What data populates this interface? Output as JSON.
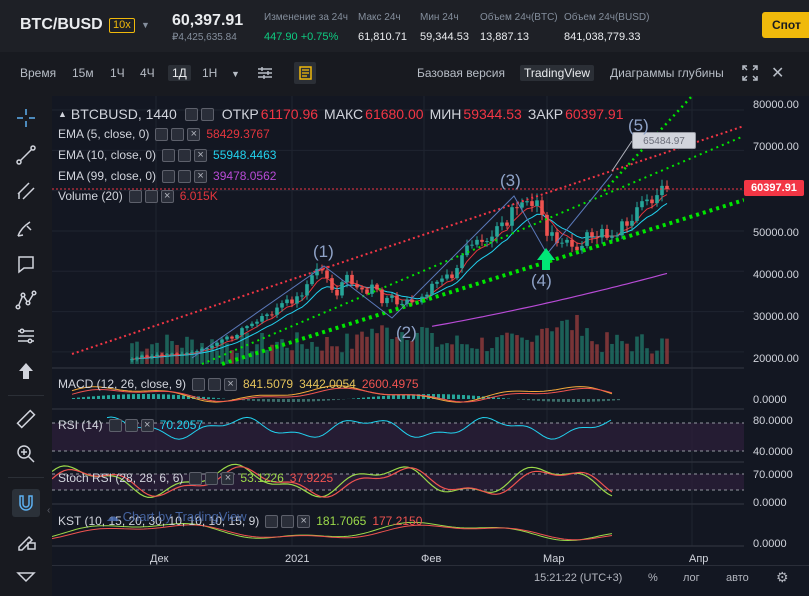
{
  "header": {
    "symbol": "BTC/BUSD",
    "leverage": "10x",
    "last_price": "60,397.91",
    "last_price_local": "₽4,425,635.84",
    "stats": [
      {
        "label": "Изменение за 24ч",
        "value": "447.90 +0.75%"
      },
      {
        "label": "Макс 24ч",
        "value": "61,810.71"
      },
      {
        "label": "Мин 24ч",
        "value": "59,344.53"
      },
      {
        "label": "Объем 24ч(BTC)",
        "value": "13,887.13"
      },
      {
        "label": "Объем 24ч(BUSD)",
        "value": "841,038,779.33"
      }
    ],
    "spot_button": "Спот"
  },
  "toolbar": {
    "time_label": "Время",
    "intervals": [
      "15м",
      "1Ч",
      "4Ч",
      "1Д",
      "1Н"
    ],
    "active_interval": "1Д",
    "views": [
      "Базовая версия",
      "TradingView",
      "Диаграммы глубины"
    ],
    "active_view": "TradingView"
  },
  "legend": {
    "symbol": "BTCBUSD, 1440",
    "open_label": "ОТКР",
    "open": "61170.96",
    "high_label": "МАКС",
    "high": "61680.00",
    "low_label": "МИН",
    "low": "59344.53",
    "close_label": "ЗАКР",
    "close": "60397.91",
    "ema5": {
      "label": "EMA (5, close, 0)",
      "value": "58429.3767",
      "color": "#e4363e"
    },
    "ema10": {
      "label": "EMA (10, close, 0)",
      "value": "55948.4463",
      "color": "#22d1ee"
    },
    "ema99": {
      "label": "EMA (99, close, 0)",
      "value": "39478.0562",
      "color": "#b84bd6"
    },
    "volume": {
      "label": "Volume (20)",
      "value": "6.015K",
      "color": "#e4363e"
    }
  },
  "indicators": {
    "macd": {
      "label": "MACD (12, 26, close, 9)",
      "v1": "841.5079",
      "v2": "3442.0054",
      "v3": "2600.4975"
    },
    "rsi": {
      "label": "RSI (14)",
      "v1": "70.2057"
    },
    "stoch": {
      "label": "Stoch RSI (28, 28, 6, 6)",
      "v1": "53.1226",
      "v2": "37.9225"
    },
    "kst": {
      "label": "KST (10, 15, 20, 30, 10, 10, 10, 15, 9)",
      "v1": "181.7065",
      "v2": "177.2150"
    }
  },
  "price_axis": [
    "80000.00",
    "70000.00",
    "50000.00",
    "40000.00",
    "30000.00",
    "20000.00"
  ],
  "current_price_tag": "60397.91",
  "callout": "65484.97",
  "macd_axis": [
    "0.0000"
  ],
  "rsi_axis": [
    "80.0000",
    "40.0000"
  ],
  "stoch_axis": [
    "70.0000",
    "0.0000"
  ],
  "kst_axis": [
    "0.0000"
  ],
  "time_axis": [
    "Дек",
    "2021",
    "Фев",
    "Мар",
    "Апр"
  ],
  "wave_labels": [
    "(1)",
    "(2)",
    "(3)",
    "(4)",
    "(5)"
  ],
  "watermark": "Chart by TradingView",
  "bottom_bar": {
    "clock": "15:21:22 (UTC+3)",
    "percent": "%",
    "log": "лог",
    "auto": "авто"
  },
  "colors": {
    "up": "#26a69a",
    "down": "#ef5350",
    "accent": "#f0b90b",
    "trend_red": "#f23645",
    "trend_green": "#00e600"
  },
  "chart_data": {
    "type": "candlestick",
    "title": "",
    "xlabel": "",
    "ylabel": "",
    "ylim": [
      17000,
      82000
    ],
    "x": [
      "Дек",
      "2021",
      "Фев",
      "Мар",
      "Апр"
    ],
    "closes": [
      18200,
      18600,
      19100,
      18800,
      19000,
      19300,
      19100,
      19400,
      19600,
      19300,
      19500,
      19700,
      19900,
      20200,
      20800,
      21000,
      21500,
      22300,
      23100,
      23800,
      23300,
      24200,
      25900,
      26400,
      27000,
      27500,
      28900,
      29300,
      29200,
      31000,
      32100,
      33000,
      32000,
      33800,
      34000,
      36800,
      39000,
      40600,
      40200,
      38300,
      35400,
      34000,
      37300,
      39100,
      36800,
      36000,
      35500,
      34400,
      36700,
      35500,
      32100,
      33400,
      34000,
      31800,
      31900,
      33000,
      32300,
      32300,
      33700,
      34200,
      36900,
      37400,
      38200,
      39200,
      38300,
      40800,
      44000,
      46400,
      46600,
      47800,
      47300,
      47500,
      48600,
      51200,
      52100,
      51300,
      55900,
      55800,
      57100,
      57400,
      56200,
      57600,
      54000,
      48800,
      49700,
      47000,
      47100,
      47800,
      46100,
      45200,
      46300,
      49700,
      48600,
      48400,
      50500,
      48300,
      48700,
      48900,
      52400,
      51300,
      52500,
      55900,
      57400,
      57800,
      56900,
      58900,
      61200,
      60400
    ],
    "ema99_end": 39478.06,
    "volume_last": "6.015K"
  }
}
